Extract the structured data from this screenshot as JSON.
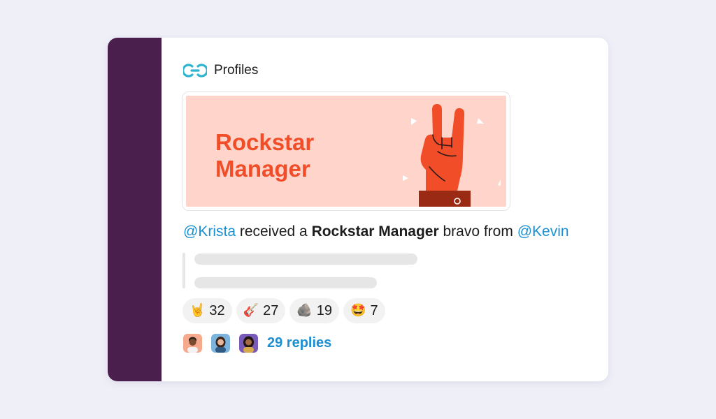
{
  "app": {
    "name": "Profiles",
    "icon": "profiles-link-logo-icon"
  },
  "banner": {
    "line1": "Rockstar",
    "line2": "Manager",
    "illustration": "rock-hand-icon",
    "colors": {
      "background": "#ffd5cb",
      "text": "#f04d28",
      "hand": "#f04d28"
    }
  },
  "message": {
    "recipient": "@Krista",
    "text_1": " received a ",
    "award": "Rockstar Manager",
    "text_2": " bravo from ",
    "sender": "@Kevin"
  },
  "reactions": [
    {
      "emoji": "🤘",
      "icon": "rock-hand-icon",
      "count": "32"
    },
    {
      "emoji": "🎸",
      "icon": "guitar-icon",
      "count": "27"
    },
    {
      "emoji": "🪨",
      "icon": "rock-icon",
      "count": "19"
    },
    {
      "emoji": "🤩",
      "icon": "star-struck-icon",
      "count": "7"
    }
  ],
  "thread": {
    "avatars": [
      "avatar-1",
      "avatar-2",
      "avatar-3"
    ],
    "replies_label": "29 replies"
  },
  "colors": {
    "page_background": "#efeff8",
    "sidebar": "#4a1f4d",
    "mention": "#1b8fd1",
    "logo": "#2fb5d0"
  }
}
